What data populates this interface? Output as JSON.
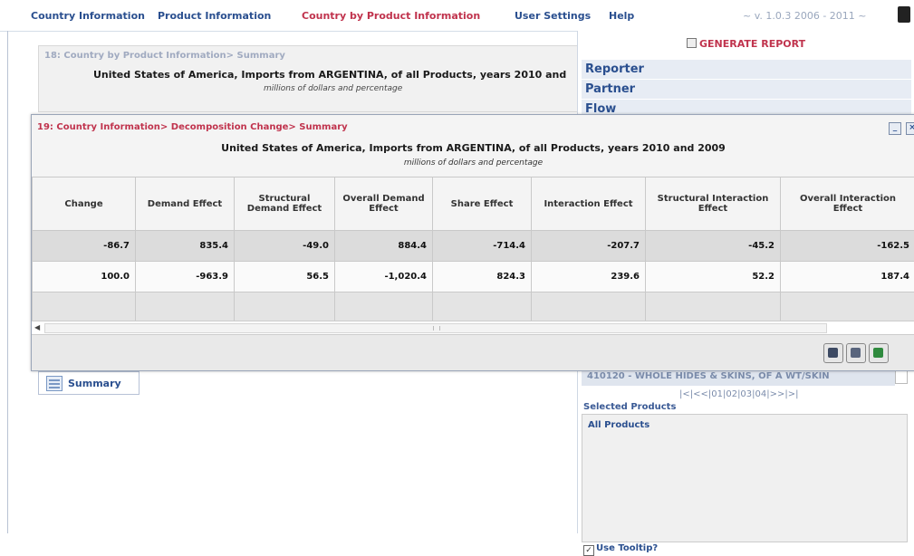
{
  "menu": {
    "items": [
      {
        "label": "Country Information",
        "active": false
      },
      {
        "label": "Product Information",
        "active": false
      },
      {
        "label": "Country by Product Information",
        "active": true
      },
      {
        "label": "User Settings",
        "active": false
      },
      {
        "label": "Help",
        "active": false
      }
    ],
    "version": "~ v. 1.0.3 2006 - 2011 ~"
  },
  "window18": {
    "title": "18: Country by Product Information> Summary",
    "report_title": "United States of America, Imports from ARGENTINA, of all Products, years 2010 and",
    "report_subtitle": "millions of dollars and percentage"
  },
  "window19": {
    "title": "19: Country Information> Decomposition Change> Summary",
    "minimize_label": "_",
    "close_label": "×",
    "report_title": "United States of America, Imports from ARGENTINA, of all Products, years 2010 and 2009",
    "report_subtitle": "millions of dollars and percentage",
    "table": {
      "headers": [
        "Change",
        "Demand Effect",
        "Structural Demand Effect",
        "Overall Demand Effect",
        "Share Effect",
        "Interaction Effect",
        "Structural Interaction Effect",
        "Overall Interaction Effect"
      ],
      "rows": [
        [
          "-86.7",
          "835.4",
          "-49.0",
          "884.4",
          "-714.4",
          "-207.7",
          "-45.2",
          "-162.5"
        ],
        [
          "100.0",
          "-963.9",
          "56.5",
          "-1,020.4",
          "824.3",
          "239.6",
          "52.2",
          "187.4"
        ],
        [
          "",
          "",
          "",
          "",
          "",
          "",
          "",
          ""
        ]
      ]
    },
    "footer_icons": [
      "print-icon",
      "printer-icon",
      "excel-export-icon"
    ]
  },
  "right_panel": {
    "generate_report": "GENERATE REPORT",
    "items": [
      "Reporter",
      "Partner",
      "Flow"
    ],
    "product_row": "410120 - WHOLE HIDES & SKINS, OF A WT/SKIN",
    "pager": "|<|<<|01|02|03|04|>>|>|",
    "selected_label": "Selected Products",
    "selected_items": [
      "All Products"
    ],
    "tooltip_label": "Use Tooltip?",
    "tooltip_checked": true
  },
  "summary_tab": {
    "label": "Summary"
  },
  "colors": {
    "menu_text": "#2a4f8f",
    "active": "#c0334d",
    "panel_item_bg": "#e7ecf4"
  }
}
